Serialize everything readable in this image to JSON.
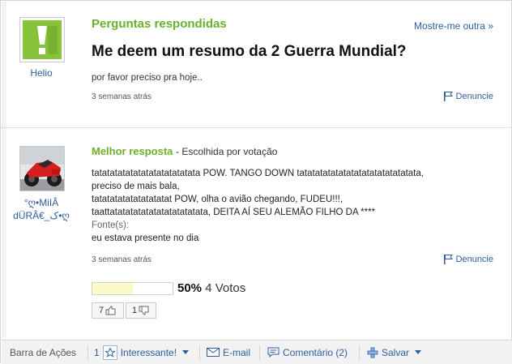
{
  "question": {
    "section_title": "Perguntas respondidas",
    "more_link": "Mostre-me outra »",
    "title": "Me deem um resumo da 2 Guerra Mundial?",
    "body": "por favor preciso pra hoje..",
    "time": "3 semanas atrás",
    "report": "Denuncie",
    "user": "Helio"
  },
  "answer": {
    "best_label": "Melhor resposta",
    "best_note": "- Escolhida por votação",
    "user_line1": "°ღ•MiIÂ",
    "user_line2": "dÜRÂ€_ک•ღ",
    "lines": [
      "tatatatatatatatatatatatatata POW. TANGO DOWN tatatatatatatatatatatatatatatata,",
      "preciso de mais bala,",
      "tatatatatatatatatatat POW, olha o avião chegando, FUDEU!!!,",
      "taattatatatatatatatatatatatata, DEITA AÍ SEU ALEMÃO FILHO DA ****"
    ],
    "sources_label": "Fonte(s):",
    "sources": "eu estava presente no dia",
    "time": "3 semanas atrás",
    "report": "Denuncie",
    "vote_percent": "50%",
    "vote_fraction": 0.5,
    "vote_count": "4 Votos",
    "thumbs_up": "7",
    "thumbs_down": "1"
  },
  "action_bar": {
    "label": "Barra de Ações",
    "interesting_count": "1",
    "interesting": "Interessante!",
    "email": "E-mail",
    "comment": "Comentário (2)",
    "save": "Salvar"
  },
  "colors": {
    "accent_green": "#6ab02c",
    "link_blue": "#2e5d9e",
    "avatar_green": "#86c23a"
  }
}
